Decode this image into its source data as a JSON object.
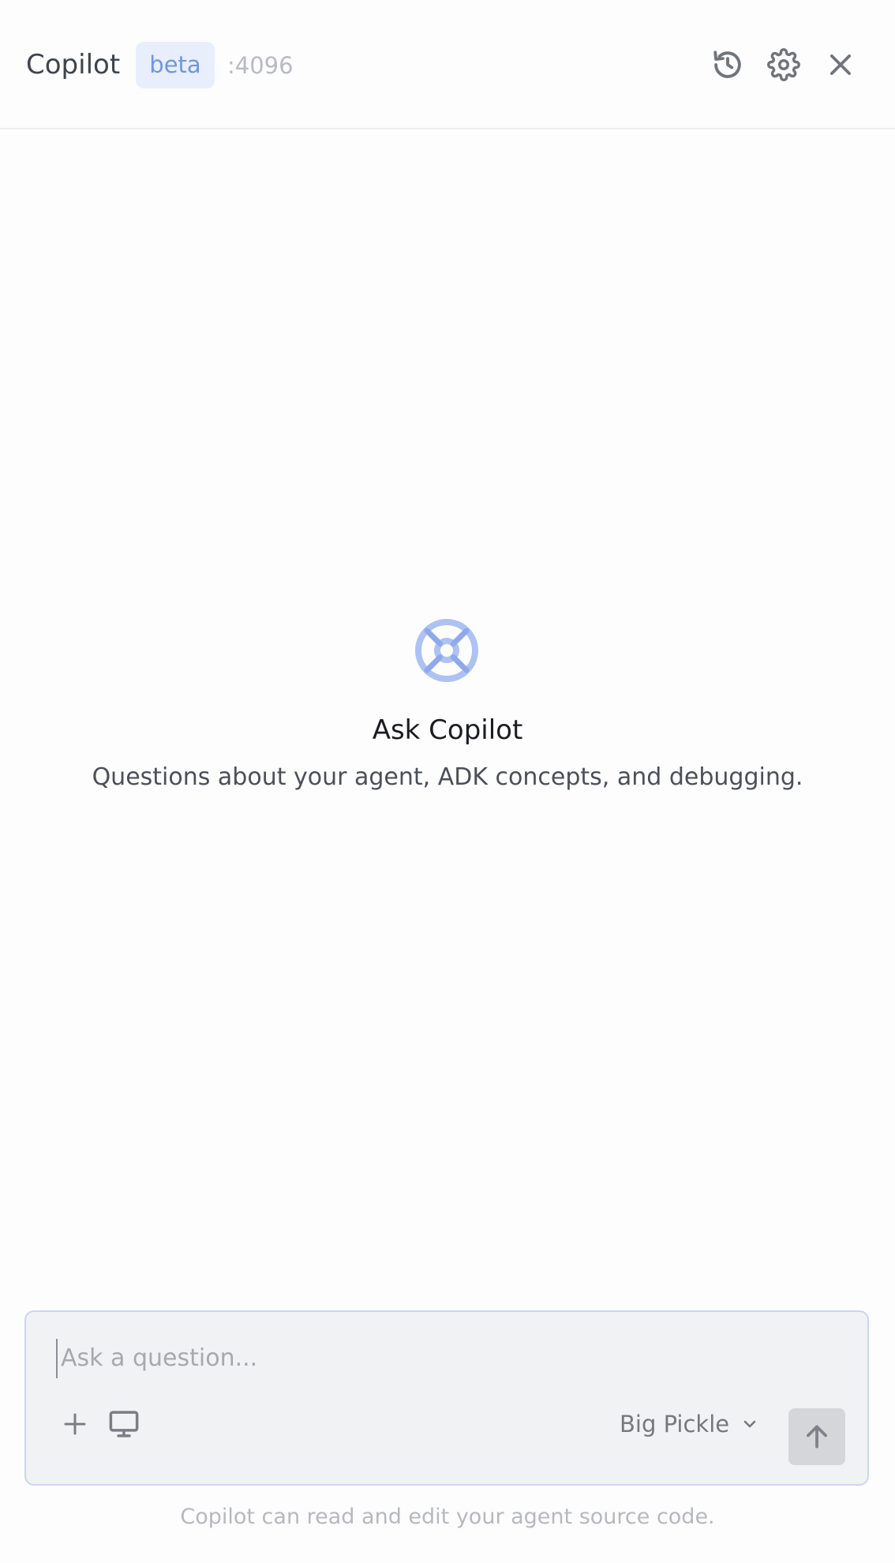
{
  "header": {
    "title": "Copilot",
    "badge": "beta",
    "port": ":4096",
    "icons": {
      "history": "history-icon",
      "settings": "gear-icon",
      "close": "close-icon"
    }
  },
  "empty_state": {
    "icon": "copilot-lifebuoy-icon",
    "title": "Ask Copilot",
    "subtitle": "Questions about your agent, ADK concepts, and debugging."
  },
  "composer": {
    "placeholder": "Ask a question...",
    "value": "",
    "tools": [
      "plus-icon",
      "monitor-icon"
    ],
    "model": "Big Pickle",
    "send_icon": "arrow-up-icon"
  },
  "footer": {
    "note": "Copilot can read and edit your agent source code."
  },
  "colors": {
    "accent": "#6f96e2",
    "badge_bg": "#e8eefb",
    "composer_border": "#c9d7f3",
    "composer_bg": "#f1f2f4",
    "send_bg": "#d5d6d9"
  }
}
